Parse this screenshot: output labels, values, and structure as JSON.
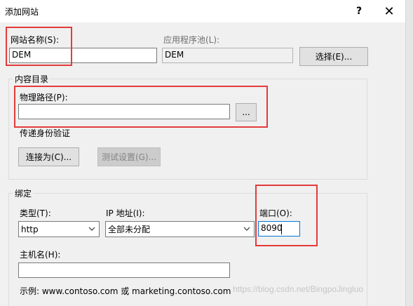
{
  "dialog": {
    "title": "添加网站",
    "help_label": "?",
    "close_label": "✕"
  },
  "site": {
    "name_label": "网站名称(S):",
    "name_value": "DEM",
    "pool_label": "应用程序池(L):",
    "pool_value": "DEM",
    "select_label": "选择(E)..."
  },
  "content": {
    "group_title": "内容目录",
    "path_label": "物理路径(P):",
    "path_value": "",
    "browse_label": "...",
    "auth_label": "传递身份验证",
    "connect_label": "连接为(C)...",
    "test_label": "测试设置(G)..."
  },
  "binding": {
    "group_title": "绑定",
    "type_label": "类型(T):",
    "type_value": "http",
    "ip_label": "IP 地址(I):",
    "ip_value": "全部未分配",
    "port_label": "端口(O):",
    "port_value": "8090",
    "host_label": "主机名(H):",
    "host_value": "",
    "example_text": "示例: www.contoso.com 或 marketing.contoso.com"
  },
  "watermark": "https://blog.csdn.net/BingpoJingluo",
  "colors": {
    "highlight": "#e33b3b",
    "focus": "#0078d7",
    "background": "#f0f0f0"
  }
}
